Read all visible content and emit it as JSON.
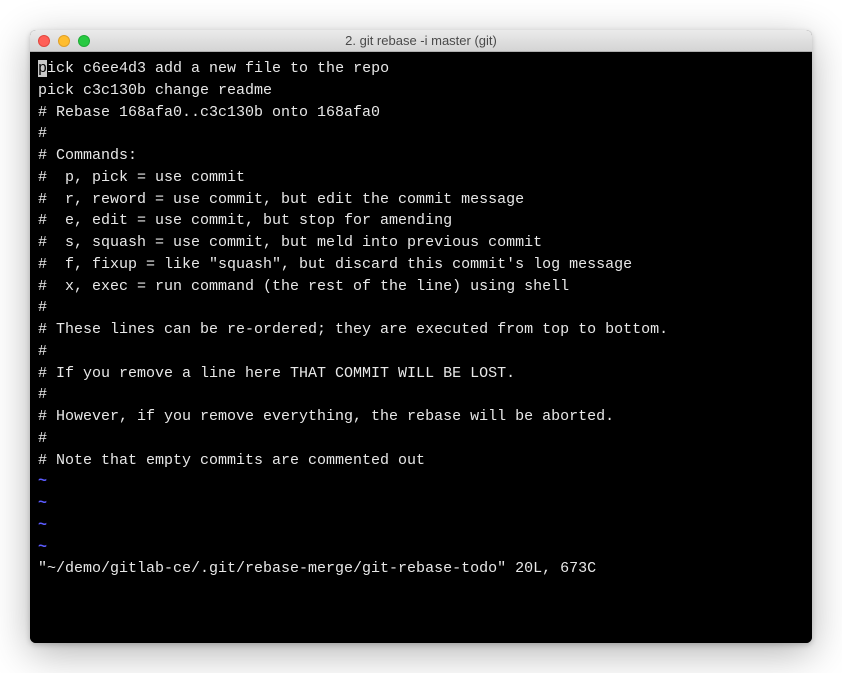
{
  "window": {
    "title": "2. git rebase -i master (git)"
  },
  "editor": {
    "cursor_char": "p",
    "line1_rest": "ick c6ee4d3 add a new file to the repo",
    "line2": "pick c3c130b change readme",
    "blank": "",
    "c1": "# Rebase 168afa0..c3c130b onto 168afa0",
    "c2": "#",
    "c3": "# Commands:",
    "c4": "#  p, pick = use commit",
    "c5": "#  r, reword = use commit, but edit the commit message",
    "c6": "#  e, edit = use commit, but stop for amending",
    "c7": "#  s, squash = use commit, but meld into previous commit",
    "c8": "#  f, fixup = like \"squash\", but discard this commit's log message",
    "c9": "#  x, exec = run command (the rest of the line) using shell",
    "c10": "#",
    "c11": "# These lines can be re-ordered; they are executed from top to bottom.",
    "c12": "#",
    "c13": "# If you remove a line here THAT COMMIT WILL BE LOST.",
    "c14": "#",
    "c15": "# However, if you remove everything, the rebase will be aborted.",
    "c16": "#",
    "c17": "# Note that empty commits are commented out",
    "tilde": "~",
    "status": "\"~/demo/gitlab-ce/.git/rebase-merge/git-rebase-todo\" 20L, 673C"
  }
}
